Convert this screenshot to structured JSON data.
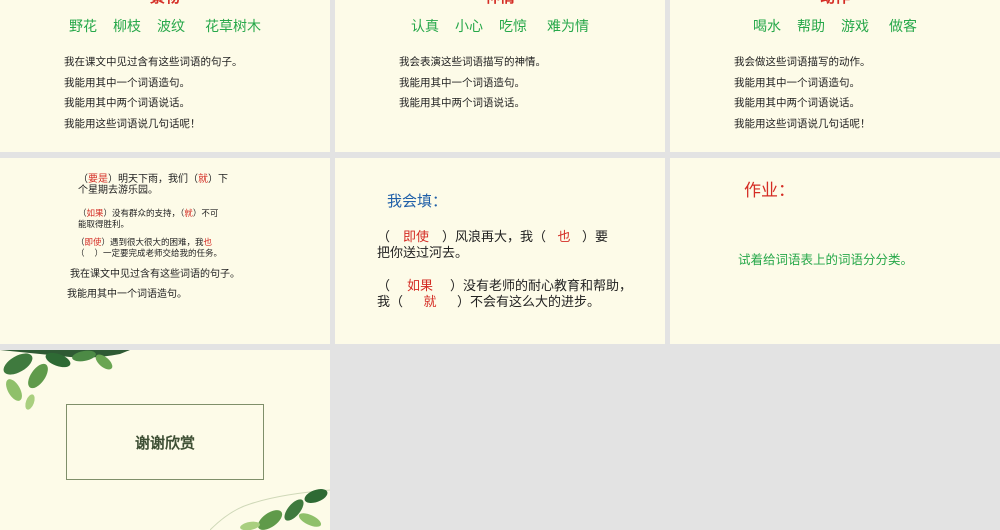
{
  "slides": [
    {
      "title": "景物",
      "words": [
        "野花",
        "柳枝",
        "波纹",
        "花草树木"
      ],
      "tasks": [
        "我在课文中见过含有这些词语的句子。",
        "我能用其中一个词语造句。",
        "我能用其中两个词语说话。",
        "我能用这些词语说几句话呢！"
      ]
    },
    {
      "title": "神情",
      "words": [
        "认真",
        "小心",
        "吃惊",
        "难为情"
      ],
      "tasks": [
        "我会表演这些词语描写的神情。",
        "我能用其中一个词语造句。",
        "我能用其中两个词语说话。"
      ]
    },
    {
      "title": "动作",
      "words": [
        "喝水",
        "帮助",
        "游戏",
        "做客"
      ],
      "tasks": [
        "我会做这些词语描写的动作。",
        "我能用其中一个词语造句。",
        "我能用其中两个词语说话。",
        "我能用这些词语说几句话呢！"
      ]
    }
  ],
  "slide4": {
    "s1_a": "（",
    "s1_ans1": "要是",
    "s1_b": "）明天下雨，我们（",
    "s1_ans2": "就",
    "s1_c": "）下",
    "s1_d": "个星期去游乐园。",
    "s2_a": "（",
    "s2_ans1": "如果",
    "s2_b": "）没有群众的支持，（",
    "s2_ans2": "就",
    "s2_c": "）不可",
    "s2_d": "能取得胜利。",
    "s3_a": "（",
    "s3_ans1": "即使",
    "s3_b": "）遇到很大很大的困难，我",
    "s3_ans2": "也",
    "s3_c": "（",
    "s3_d": "）一定要完成老师交给我的任务。",
    "task1": "我在课文中见过含有这些词语的句子。",
    "task2": "我能用其中一个词语造句。"
  },
  "slide5": {
    "title": "我会填：",
    "l1_a": "（",
    "l1_ans1": "即使",
    "l1_b": "）风浪再大，我（",
    "l1_ans2": "也",
    "l1_c": "）要",
    "l1_d": "把你送过河去。",
    "l2_a": "（",
    "l2_ans1": "如果",
    "l2_b": "）没有老师的耐心教育和帮助，",
    "l2_c": "我（",
    "l2_ans2": "就",
    "l2_d": "）不会有这么大的进步。"
  },
  "slide6": {
    "title": "作业：",
    "text": "试着给词语表上的词语分分类。"
  },
  "slide7": {
    "text": "谢谢欣赏"
  }
}
